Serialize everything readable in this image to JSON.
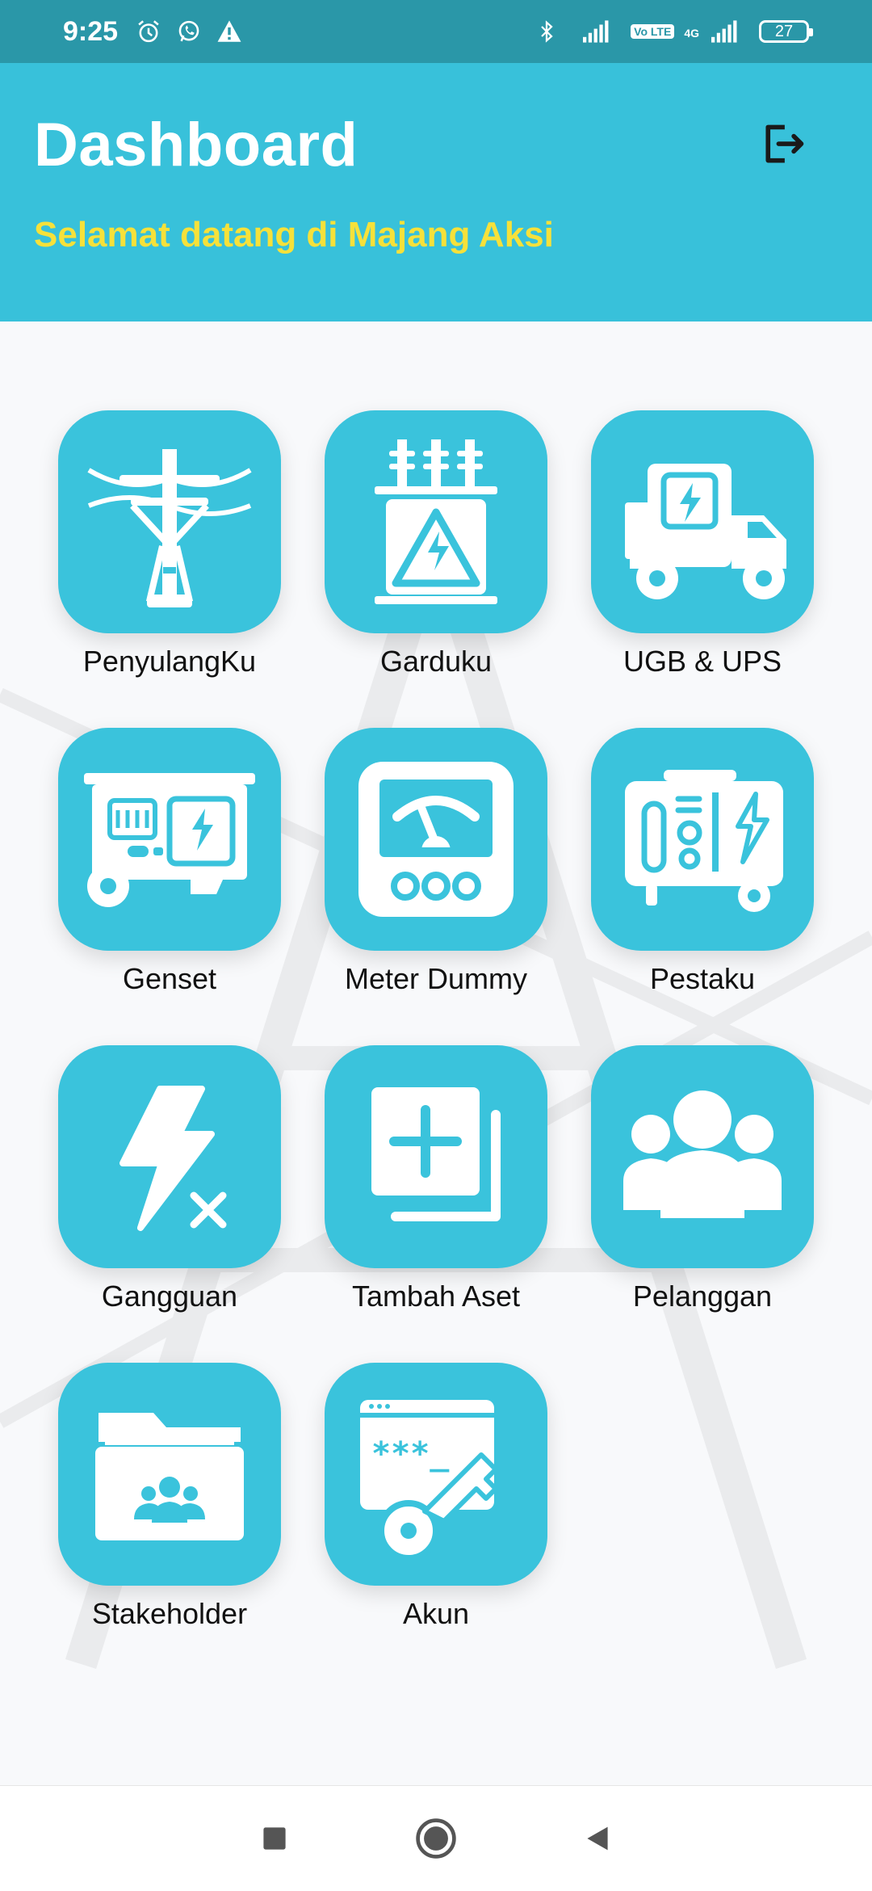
{
  "status_bar": {
    "time": "9:25",
    "battery": "27",
    "network": "4G",
    "volte": "Vo LTE",
    "icons": [
      "alarm-icon",
      "whatsapp-icon",
      "warning-icon",
      "bluetooth-icon",
      "signal-icon",
      "signal-icon"
    ]
  },
  "header": {
    "title": "Dashboard",
    "subtitle": "Selamat datang di Majang Aksi",
    "logout_icon": "logout-icon",
    "background_color": "#38c1da",
    "subtitle_color": "#f6e13a"
  },
  "menu": {
    "tile_color": "#3ac3dc",
    "items": [
      {
        "label": "PenyulangKu",
        "icon": "power-pole-icon"
      },
      {
        "label": "Garduku",
        "icon": "transformer-icon"
      },
      {
        "label": "UGB & UPS",
        "icon": "power-truck-icon"
      },
      {
        "label": "Genset",
        "icon": "generator-icon"
      },
      {
        "label": "Meter Dummy",
        "icon": "meter-icon"
      },
      {
        "label": "Pestaku",
        "icon": "mobile-generator-icon"
      },
      {
        "label": "Gangguan",
        "icon": "power-outage-icon"
      },
      {
        "label": "Tambah Aset",
        "icon": "add-asset-icon"
      },
      {
        "label": "Pelanggan",
        "icon": "customers-icon"
      },
      {
        "label": "Stakeholder",
        "icon": "stakeholder-folder-icon"
      },
      {
        "label": "Akun",
        "icon": "account-key-icon"
      }
    ]
  },
  "nav_bar": {
    "icons": [
      "recents-square-icon",
      "home-circle-icon",
      "back-triangle-icon"
    ]
  }
}
